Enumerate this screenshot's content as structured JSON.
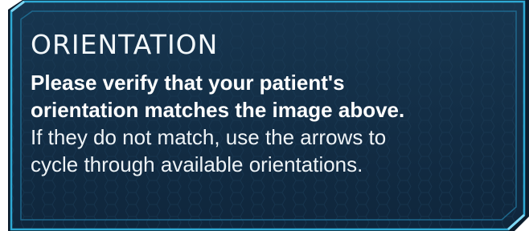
{
  "dialog": {
    "title": "ORIENTATION",
    "message_bold_line1": "Please verify that your patient's",
    "message_bold_line2": "orientation matches the image above.",
    "message_line3": "If they do not match, use the arrows to",
    "message_line4": "cycle through available orientations."
  },
  "colors": {
    "panel_fill": "#143048",
    "panel_fill_dark": "#0d2236",
    "outer_border": "#33b4dc",
    "inner_border": "#1d6f95",
    "text": "#ffffff"
  }
}
